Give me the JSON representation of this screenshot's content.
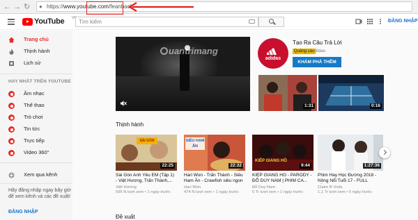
{
  "browser": {
    "url_prefix": "https://",
    "url_host": "www.youtube.com",
    "url_path": "/feanback"
  },
  "masthead": {
    "logo_text": "YouTube",
    "logo_region": "VN",
    "search_placeholder": "Tìm kiếm",
    "login_label": "ĐĂNG NHẬP"
  },
  "sidebar": {
    "primary": [
      {
        "label": "Trang chủ",
        "icon": "home-icon"
      },
      {
        "label": "Thịnh hành",
        "icon": "flame-icon"
      },
      {
        "label": "Lịch sử",
        "icon": "history-icon"
      }
    ],
    "best_heading": "HAY NHẤT TRÊN YOUTUBE",
    "categories": [
      {
        "label": "Âm nhạc"
      },
      {
        "label": "Thể thao"
      },
      {
        "label": "Trò chơi"
      },
      {
        "label": "Tin tức"
      },
      {
        "label": "Trực tiếp"
      },
      {
        "label": "Video 360°"
      }
    ],
    "browse_channels": "Xem qua kênh",
    "login_prompt": "Hãy đăng nhập ngay bây giờ để xem kênh và các đề xuất!",
    "login_label": "ĐĂNG NHẬP"
  },
  "hero": {
    "watermark": "uantrimang"
  },
  "ad": {
    "title": "Tạo Ra Câu Trả Lời",
    "badge": "Quảng cáo",
    "channel": "adidas",
    "logo_brand": "adidas",
    "cta": "KHÁM PHÁ THÊM"
  },
  "ad_thumbs": [
    {
      "duration": ""
    },
    {
      "duration": ""
    },
    {
      "duration": "1:31"
    },
    {
      "duration": "0:16"
    }
  ],
  "trending": {
    "title": "Thịnh hành",
    "videos": [
      {
        "duration": "22:25",
        "title": "Sài Gòn Anh Yêu EM (Tập 1) - Việt Hương, Trấn Thành,...",
        "channel": "Việt Hương",
        "meta": "595 N lượt xem • 1 ngày trước",
        "thumb_text": "SÀI GÒN"
      },
      {
        "duration": "22:32",
        "title": "Hari Won - Trấn Thành - Siêu Ham Ăn - Crawfish siêu ngon",
        "channel": "Hari Won",
        "meta": "474 N lượt xem • 1 ngày trước",
        "thumb_text": "SIÊU HAM ĂN"
      },
      {
        "duration": "9:44",
        "title": "KIỆP GIANG HỒ - PARODY - ĐỖ DUY NAM | PHIM CA...",
        "channel": "Đỗ Duy Nam",
        "meta": "5 Tr lượt xem • 1 ngày trước",
        "thumb_text": "KIẾP GIANG HỒ"
      },
      {
        "duration": "1:27:36",
        "title": "Phim Hay Học Đường 2018 - Nông Nổi Tuổi 17 - FULL HÌNH...",
        "channel": "Claire R Viola",
        "meta": "1,1 Tr lượt xem • 5 ngày trước",
        "thumb_text": ""
      }
    ]
  },
  "recommended": {
    "title": "Đề xuất"
  }
}
